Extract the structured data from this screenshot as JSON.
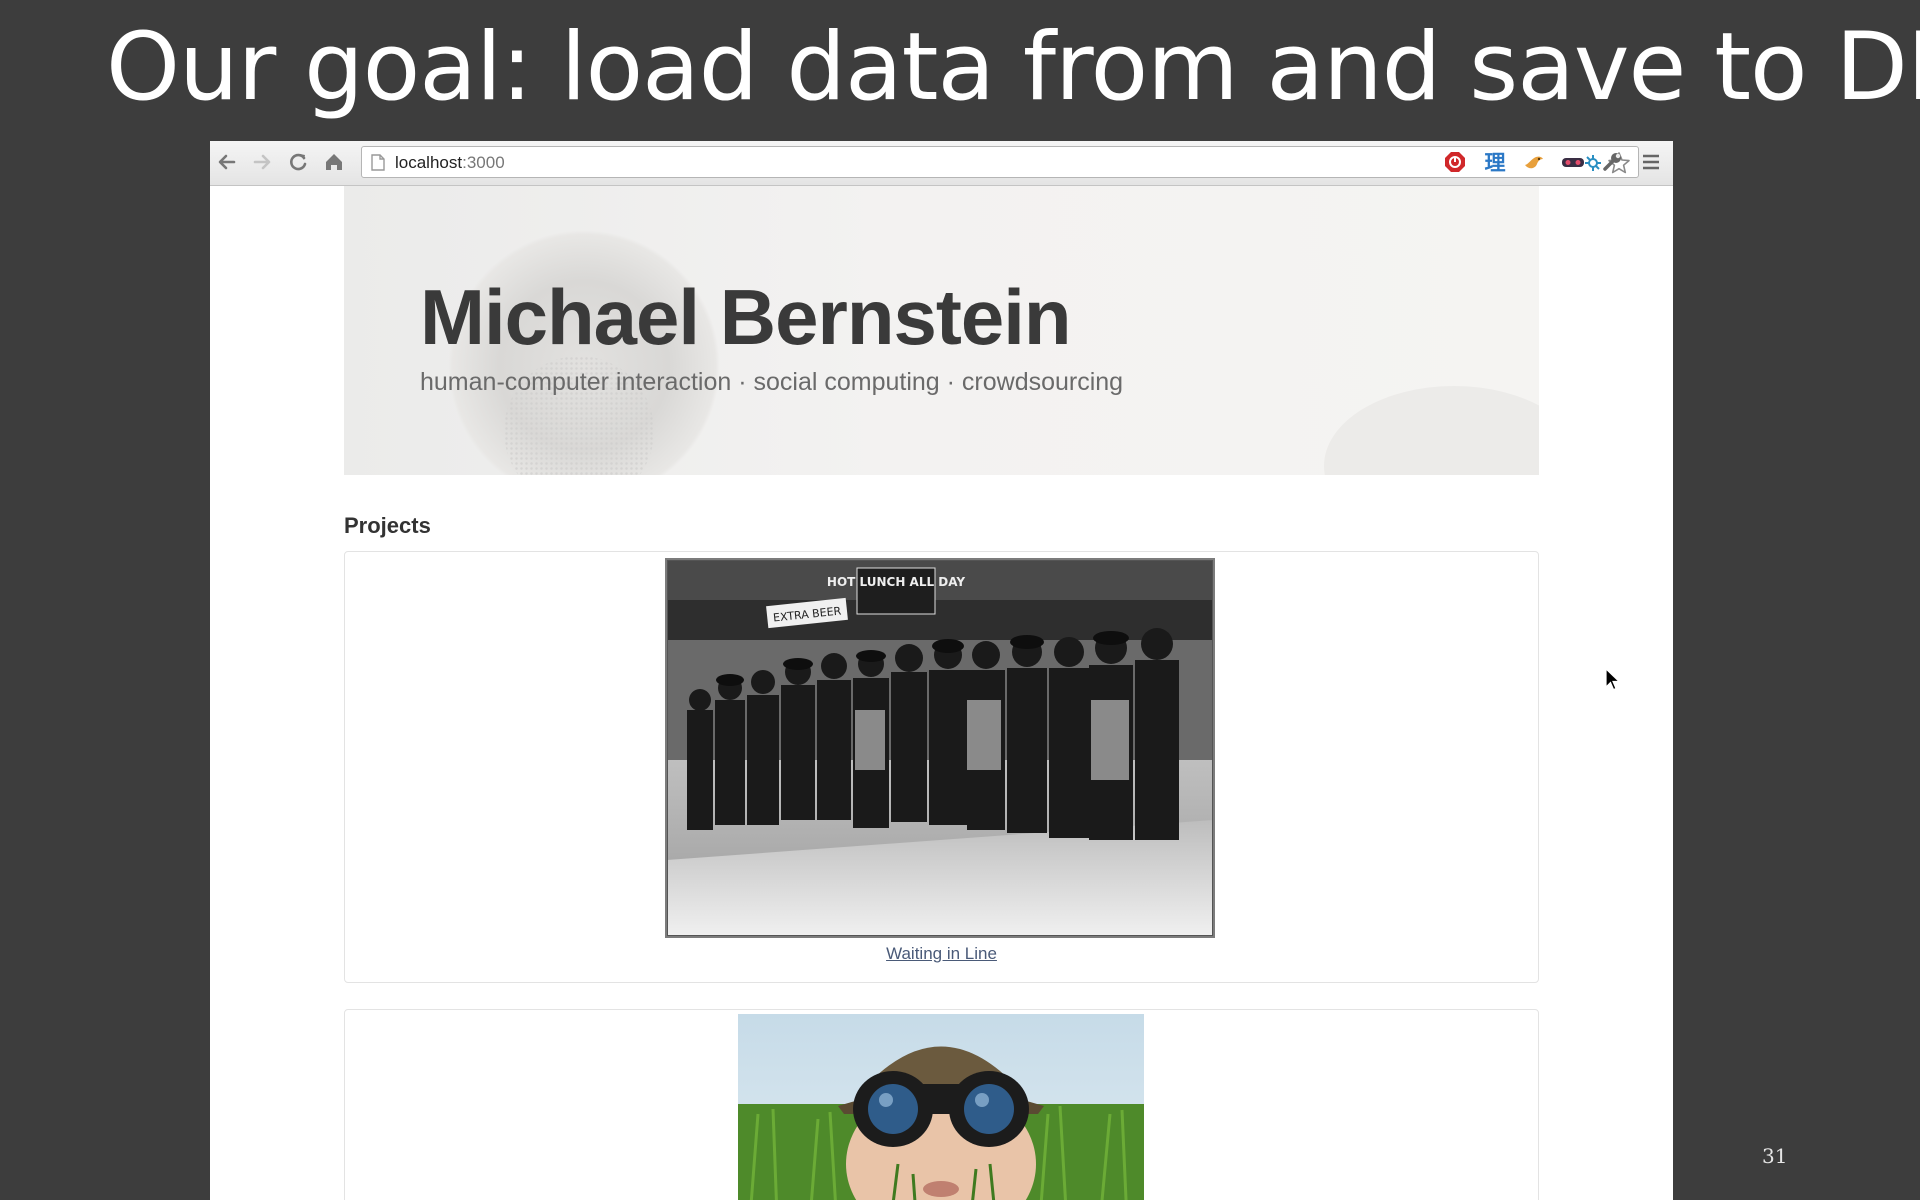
{
  "slide": {
    "title": "Our goal: load data from and save to DB",
    "number": "31"
  },
  "browser": {
    "url_host": "localhost",
    "url_port": ":3000",
    "ext_han_glyph": "理"
  },
  "site": {
    "name": "Michael Bernstein",
    "tagline": "human-computer interaction · social computing · crowdsourcing",
    "section_heading": "Projects",
    "projects": [
      {
        "title": "Waiting in Line",
        "sign_text": "HOT LUNCH ALL DAY",
        "sign_text_2": "EXTRA BEER"
      },
      {
        "title": ""
      }
    ]
  },
  "colors": {
    "slide_bg": "#3d3d3d",
    "link": "#4a5a78"
  }
}
